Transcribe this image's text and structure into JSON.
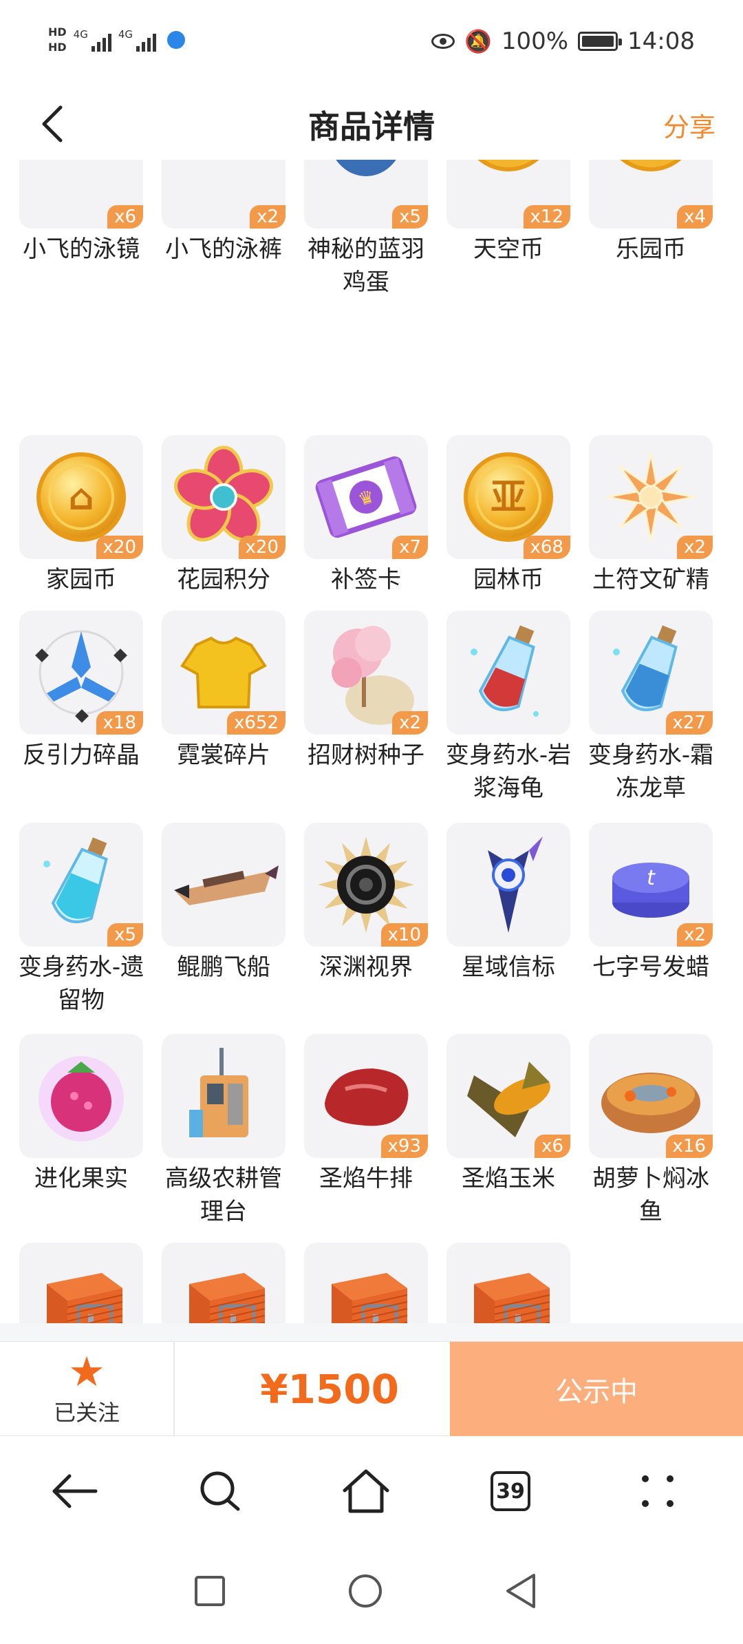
{
  "status_bar": {
    "hd1": "HD",
    "hd2": "HD",
    "net1": "4G",
    "net2": "4G",
    "battery_text": "100%",
    "time": "14:08"
  },
  "header": {
    "title": "商品详情",
    "share_label": "分享"
  },
  "rows": [
    [
      {
        "name": "小飞的泳镜",
        "qty": "x6",
        "icon": "goggles-icon"
      },
      {
        "name": "小飞的泳裤",
        "qty": "x2",
        "icon": "swim-trunks-icon"
      },
      {
        "name": "神秘的蓝羽鸡蛋",
        "qty": "x5",
        "icon": "blue-egg-icon"
      },
      {
        "name": "天空币",
        "qty": "x12",
        "icon": "sky-coin-icon"
      },
      {
        "name": "乐园币",
        "qty": "x4",
        "icon": "paradise-coin-icon"
      }
    ],
    [
      {
        "name": "家园币",
        "qty": "x20",
        "icon": "home-coin-icon"
      },
      {
        "name": "花园积分",
        "qty": "x20",
        "icon": "flower-badge-icon"
      },
      {
        "name": "补签卡",
        "qty": "x7",
        "icon": "ticket-icon"
      },
      {
        "name": "园林币",
        "qty": "x68",
        "icon": "garden-coin-icon"
      },
      {
        "name": "土符文矿精",
        "qty": "x2",
        "icon": "crystal-icon"
      }
    ],
    [
      {
        "name": "反引力碎晶",
        "qty": "x18",
        "icon": "antigravity-shard-icon"
      },
      {
        "name": "霓裳碎片",
        "qty": "x652",
        "icon": "shirt-icon"
      },
      {
        "name": "招财树种子",
        "qty": "x2",
        "icon": "seed-bag-icon"
      },
      {
        "name": "变身药水-岩浆海龟",
        "qty": "",
        "icon": "potion-red-icon"
      },
      {
        "name": "变身药水-霜冻龙草",
        "qty": "x27",
        "icon": "potion-blue-icon"
      }
    ],
    [
      {
        "name": "变身药水-遗留物",
        "qty": "x5",
        "icon": "potion-cyan-icon"
      },
      {
        "name": "鲲鹏飞船",
        "qty": "",
        "icon": "airship-icon"
      },
      {
        "name": "深渊视界",
        "qty": "x10",
        "icon": "abyss-sun-icon"
      },
      {
        "name": "星域信标",
        "qty": "",
        "icon": "beacon-icon"
      },
      {
        "name": "七字号发蜡",
        "qty": "x2",
        "icon": "hair-wax-icon"
      }
    ],
    [
      {
        "name": "进化果实",
        "qty": "",
        "icon": "evolution-fruit-icon"
      },
      {
        "name": "高级农耕管理台",
        "qty": "",
        "icon": "farm-console-icon"
      },
      {
        "name": "圣焰牛排",
        "qty": "x93",
        "icon": "steak-icon"
      },
      {
        "name": "圣焰玉米",
        "qty": "x6",
        "icon": "corn-icon"
      },
      {
        "name": "胡萝卜焖冰鱼",
        "qty": "x16",
        "icon": "fish-stew-icon"
      }
    ],
    [
      {
        "name": "木制储物箱",
        "qty": "",
        "icon": "wooden-chest-icon"
      },
      {
        "name": "木制储物箱",
        "qty": "",
        "icon": "wooden-chest-icon"
      },
      {
        "name": "木制储物箱",
        "qty": "",
        "icon": "wooden-chest-icon"
      },
      {
        "name": "木制储物箱",
        "qty": "",
        "icon": "wooden-chest-icon"
      }
    ]
  ],
  "bottom_bar": {
    "follow_label": "已关注",
    "price": "¥1500",
    "status_label": "公示中"
  },
  "browser_nav": {
    "tab_count": "39"
  },
  "colors": {
    "accent": "#f26a1b",
    "badge": "#f39a4a",
    "status_button": "#fcae7c",
    "share": "#f08a2c"
  }
}
